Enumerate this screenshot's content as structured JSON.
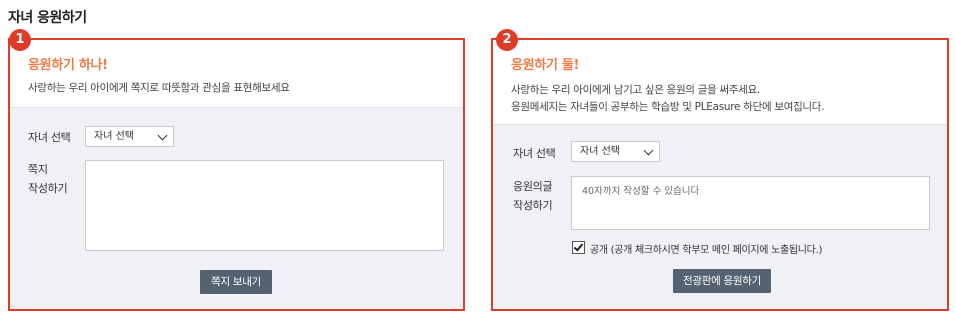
{
  "page": {
    "title": "자녀 응원하기"
  },
  "panel1": {
    "badge": "1",
    "title": "응원하기 하나!",
    "description": "사랑하는 우리 아이에게 쪽지로 따뜻함과 관심을 표현해보세요",
    "child_select_label": "자녀 선택",
    "child_select_value": "자녀 선택",
    "note_label_line1": "쪽지",
    "note_label_line2": "작성하기",
    "note_value": "",
    "send_button": "쪽지 보내기"
  },
  "panel2": {
    "badge": "2",
    "title": "응원하기 둘!",
    "description_line1": "사랑하는 우리 아이에게 남기고 싶은 응원의 글을 써주세요.",
    "description_line2": "응원메세지는 자녀들이 공부하는 학습방 및 PLEasure 하단에 보여집니다.",
    "child_select_label": "자녀 선택",
    "child_select_value": "자녀 선택",
    "message_label_line1": "응원의글",
    "message_label_line2": "작성하기",
    "message_placeholder": "40자까지 작성할 수 있습니다",
    "public_checkbox_label": "공개 (공개 체크하시면 학부모 메인 페이지에 노출됩니다.)",
    "public_checked": true,
    "submit_button": "전광판에 응원하기"
  },
  "colors": {
    "accent_red": "#e03a28",
    "title_orange": "#f07a45",
    "button_slate": "#556272"
  }
}
